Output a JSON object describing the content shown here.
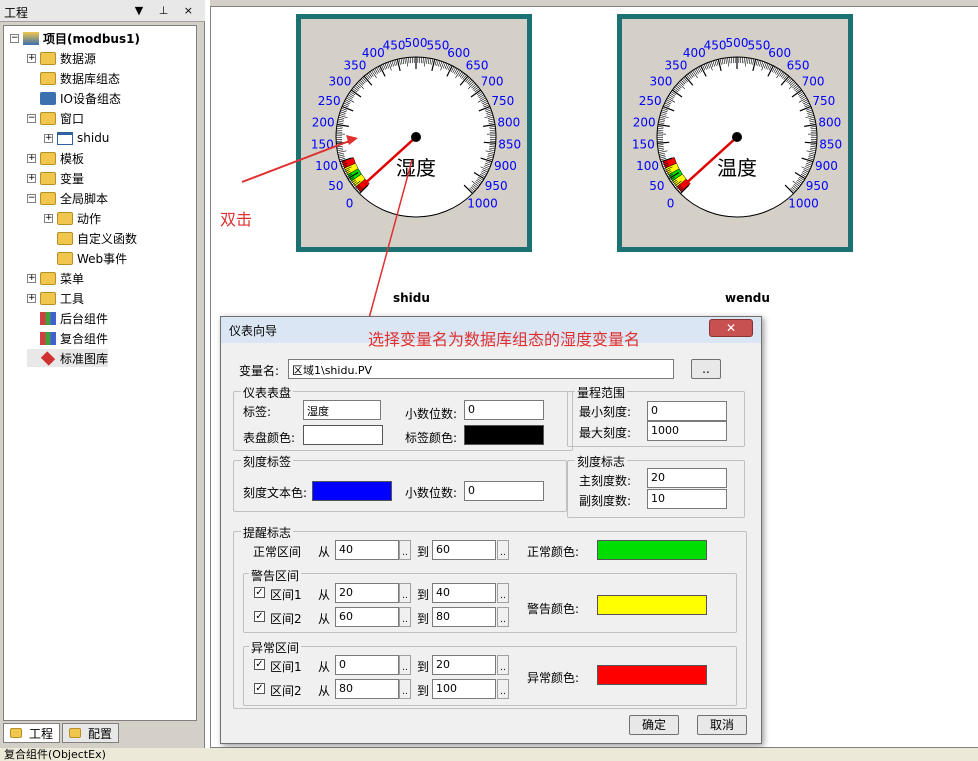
{
  "panel": {
    "title": "工程",
    "pin_buttons": "▼ ⊥ ×"
  },
  "tree": [
    {
      "label": "项目(modbus1)",
      "bold": true,
      "indent": 0,
      "exp": "-",
      "icon": "project-icon"
    },
    {
      "label": "数据源",
      "indent": 1,
      "exp": "+",
      "icon": "folder-icon"
    },
    {
      "label": "数据库组态",
      "indent": 1,
      "exp": "",
      "icon": "folder-icon"
    },
    {
      "label": "IO设备组态",
      "indent": 1,
      "exp": "",
      "icon": "network-icon"
    },
    {
      "label": "窗口",
      "indent": 1,
      "exp": "-",
      "icon": "folder-icon"
    },
    {
      "label": "shidu",
      "indent": 2,
      "exp": "+",
      "icon": "window-icon"
    },
    {
      "label": "模板",
      "indent": 1,
      "exp": "+",
      "icon": "folder-icon"
    },
    {
      "label": "变量",
      "indent": 1,
      "exp": "+",
      "icon": "folder-icon"
    },
    {
      "label": "全局脚本",
      "indent": 1,
      "exp": "-",
      "icon": "folder-icon"
    },
    {
      "label": "动作",
      "indent": 2,
      "exp": "+",
      "icon": "folder-icon"
    },
    {
      "label": "自定义函数",
      "indent": 2,
      "exp": "",
      "icon": "folder-icon"
    },
    {
      "label": "Web事件",
      "indent": 2,
      "exp": "",
      "icon": "folder-icon"
    },
    {
      "label": "菜单",
      "indent": 1,
      "exp": "+",
      "icon": "folder-icon"
    },
    {
      "label": "工具",
      "indent": 1,
      "exp": "+",
      "icon": "folder-icon"
    },
    {
      "label": "后台组件",
      "indent": 1,
      "exp": "",
      "icon": "component-icon"
    },
    {
      "label": "复合组件",
      "indent": 1,
      "exp": "",
      "icon": "component-icon"
    },
    {
      "label": "标准图库",
      "indent": 1,
      "exp": "",
      "icon": "library-icon"
    }
  ],
  "tabs": [
    "工程",
    "配置"
  ],
  "status": "复合组件(ObjectEx)",
  "gauges": [
    {
      "name": "shidu",
      "center_text": "湿度"
    },
    {
      "name": "wendu",
      "center_text": "温度"
    }
  ],
  "gauge_ticks": [
    "0",
    "50",
    "100",
    "150",
    "200",
    "250",
    "300",
    "350",
    "400",
    "450",
    "500",
    "550",
    "600",
    "650",
    "700",
    "750",
    "800",
    "850",
    "900",
    "950",
    "1000"
  ],
  "annotations": {
    "dblclick": "双击",
    "select": "选择变量名为数据库组态的湿度变量名"
  },
  "dialog": {
    "title": "仪表向导",
    "close": "✕",
    "var_label": "变量名:",
    "var_value": "区域1\\shidu.PV",
    "browse": "..",
    "dial": {
      "title": "仪表表盘",
      "label_lbl": "标签:",
      "label_val": "湿度",
      "decimals_lbl": "小数位数:",
      "decimals_val": "0",
      "dial_color_lbl": "表盘颜色:",
      "label_color_lbl": "标签颜色:"
    },
    "range": {
      "title": "量程范围",
      "min_lbl": "最小刻度:",
      "min_val": "0",
      "max_lbl": "最大刻度:",
      "max_val": "1000"
    },
    "scale_label": {
      "title": "刻度标签",
      "text_color_lbl": "刻度文本色:",
      "decimals_lbl": "小数位数:",
      "decimals_val": "0"
    },
    "scale_mark": {
      "title": "刻度标志",
      "major_lbl": "主刻度数:",
      "major_val": "20",
      "minor_lbl": "副刻度数:",
      "minor_val": "10"
    },
    "alarm": {
      "title": "提醒标志",
      "normal_lbl": "正常区间",
      "from": "从",
      "to": "到",
      "normal_from": "40",
      "normal_to": "60",
      "normal_color_lbl": "正常颜色:",
      "warn_title": "警告区间",
      "warn1_lbl": "区间1",
      "warn1_from": "20",
      "warn1_to": "40",
      "warn2_lbl": "区间2",
      "warn2_from": "60",
      "warn2_to": "80",
      "warn_color_lbl": "警告颜色:",
      "err_title": "异常区间",
      "err1_lbl": "区间1",
      "err1_from": "0",
      "err1_to": "20",
      "err2_lbl": "区间2",
      "err2_from": "80",
      "err2_to": "100",
      "err_color_lbl": "异常颜色:"
    },
    "ok": "确定",
    "cancel": "取消",
    "colors": {
      "dial": "#ffffff",
      "label": "#000000",
      "tick_text": "#0000ff",
      "normal": "#00dd00",
      "warn": "#ffff00",
      "err": "#ff0000"
    }
  }
}
